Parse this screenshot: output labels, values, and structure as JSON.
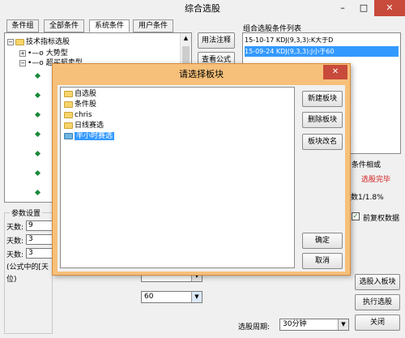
{
  "window": {
    "title": "综合选股"
  },
  "tabs": [
    "条件组",
    "全部条件",
    "系统条件",
    "用户条件"
  ],
  "tree": {
    "root": "技术指标选股",
    "child1": "大势型",
    "child2": "超买超卖型"
  },
  "side_buttons": {
    "usage_note": "用法注释",
    "view_formula": "查看公式"
  },
  "list_panel": {
    "title": "组合选股条件列表",
    "items": [
      "15-10-17 KDJ(9,3,3):K大于D",
      "15-09-24 KDJ(9,3,3):J小于60"
    ]
  },
  "right_info": {
    "condition_relation": "条件相或",
    "status": "选股完毕",
    "ratio": "数1/1.8%",
    "adjust_label": "前复权数据",
    "adjust_checked": true
  },
  "params": {
    "title": "参数设置",
    "rows": [
      {
        "label": "天数:",
        "value": "9"
      },
      {
        "label": "天数:",
        "value": "3"
      },
      {
        "label": "天数:",
        "value": "3"
      }
    ],
    "note_line1": "(公式中的[天",
    "note_line2": "位)"
  },
  "mid_selects": {
    "sel1": "",
    "sel2": "60"
  },
  "bottom_buttons": {
    "select_into_board": "选股入板块",
    "execute": "执行选股",
    "close": "关闭"
  },
  "period": {
    "label": "选股周期:",
    "value": "30分钟"
  },
  "dialog": {
    "title": "请选择板块",
    "boards": [
      "自选股",
      "条件股",
      "chris",
      "日线赛选",
      "半小时赛选"
    ],
    "selected_index": 4,
    "buttons": {
      "new": "新建板块",
      "delete": "删除板块",
      "rename": "板块改名",
      "ok": "确定",
      "cancel": "取消"
    }
  },
  "colors": {
    "selection": "#3399ff",
    "close_red": "#c84a3a",
    "status_red": "#d02020",
    "dialog_border": "#f1a94a"
  }
}
